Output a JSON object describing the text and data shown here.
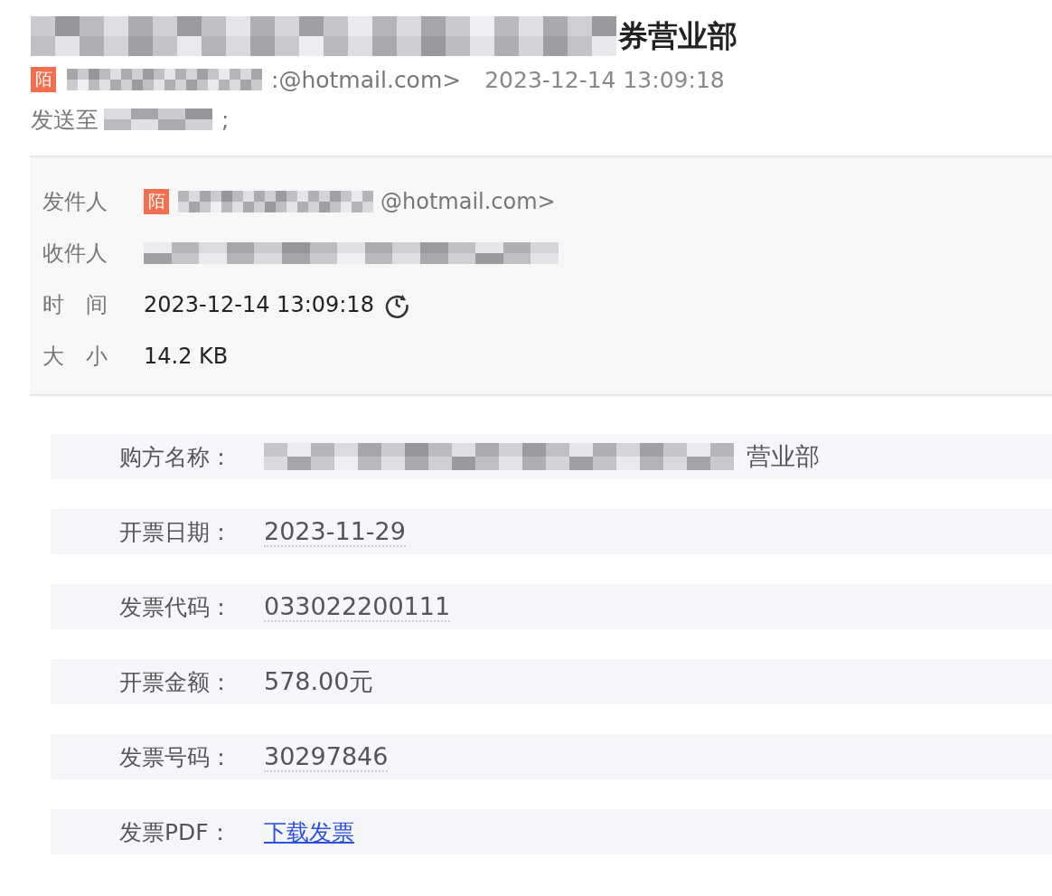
{
  "title": {
    "visible_text": "券营业部"
  },
  "summary": {
    "sender_badge": "陌",
    "sender_address": ":@hotmail.com>",
    "time": "2023-12-14 13:09:18",
    "to_label": "发送至",
    "to_suffix": ";"
  },
  "details": [
    {
      "kind": "sender",
      "label": "发件人",
      "badge": "陌",
      "value": "@hotmail.com>"
    },
    {
      "kind": "recipient",
      "label": "收件人"
    },
    {
      "kind": "time",
      "label": "时　间",
      "value": "2023-12-14 13:09:18"
    },
    {
      "kind": "plain",
      "label": "大　小",
      "value": "14.2 KB"
    }
  ],
  "invoice": [
    {
      "kind": "redacted",
      "label": "购方名称：",
      "value": "营业部"
    },
    {
      "kind": "text",
      "label": "开票日期：",
      "value": "2023-11-29",
      "underlined": true
    },
    {
      "kind": "text",
      "label": "发票代码：",
      "value": "033022200111",
      "underlined": true
    },
    {
      "kind": "text",
      "label": "开票金额：",
      "value": "578.00元",
      "underlined": false
    },
    {
      "kind": "text",
      "label": "发票号码：",
      "value": "30297846",
      "underlined": true
    },
    {
      "kind": "link",
      "label": "发票PDF：",
      "value": "下载发票"
    }
  ]
}
